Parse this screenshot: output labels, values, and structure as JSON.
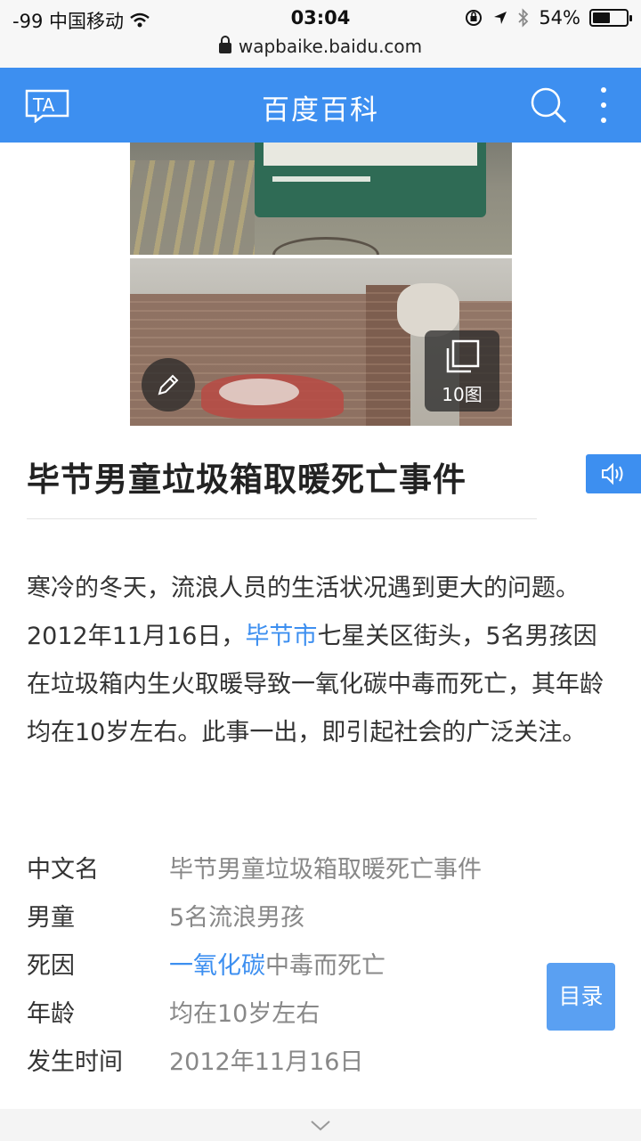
{
  "status_bar": {
    "carrier": "-99 中国移动",
    "time": "03:04",
    "battery": "54%",
    "battery_level": 0.54
  },
  "url_bar": {
    "url": "wapbaike.baidu.com"
  },
  "header": {
    "title": "百度百科",
    "logo_text": "TA"
  },
  "gallery": {
    "count_label": "10图"
  },
  "article": {
    "title": "毕节男童垃圾箱取暖死亡事件",
    "summary": {
      "part1": "寒冷的冬天，流浪人员的生活状况遇到更大的问题。2012年11月16日，",
      "link": "毕节市",
      "part2": "七星关区街头，5名男孩因在垃圾箱内生火取暖导致一氧化碳中毒而死亡，其年龄均在10岁左右。此事一出，即引起社会的广泛关注。"
    }
  },
  "info_box": {
    "rows": [
      {
        "key": "中文名",
        "value": "毕节男童垃圾箱取暖死亡事件"
      },
      {
        "key": "男童",
        "value": "5名流浪男孩"
      },
      {
        "key": "死因",
        "value_link": "一氧化碳",
        "value_rest": "中毒而死亡"
      },
      {
        "key": "年龄",
        "value": "均在10岁左右"
      },
      {
        "key": "发生时间",
        "value": "2012年11月16日"
      }
    ]
  },
  "toc_button": {
    "label": "目录"
  },
  "colors": {
    "brand_blue": "#3d8ff0",
    "link_blue": "#3d8ff0"
  }
}
